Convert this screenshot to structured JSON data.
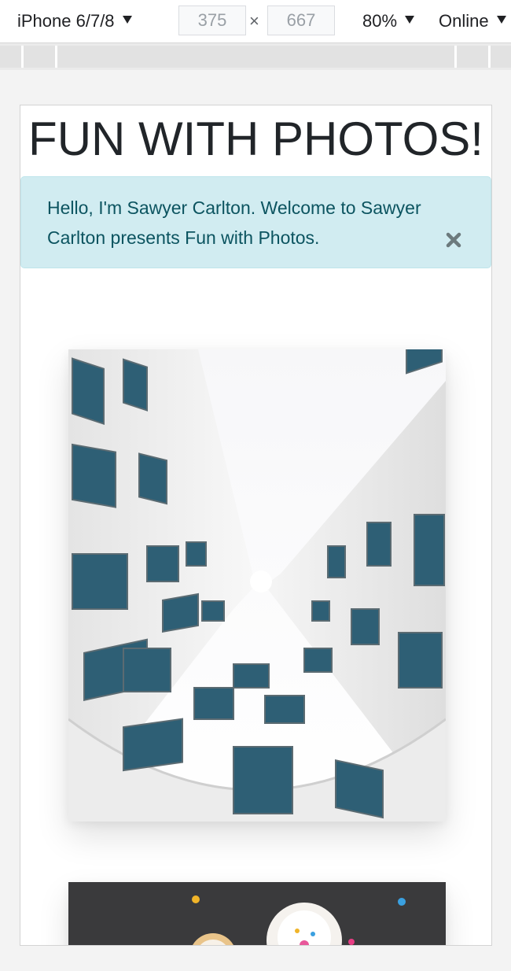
{
  "devtools": {
    "device": "iPhone 6/7/8",
    "width": "375",
    "times": "×",
    "height": "667",
    "zoom": "80%",
    "network": "Online"
  },
  "page": {
    "title": "FUN WITH PHOTOS!",
    "alert": {
      "message": "Hello, I'm Sawyer Carlton. Welcome to Sawyer Carlton presents Fun with Photos.",
      "close_icon": "close-x-icon"
    },
    "photos": [
      {
        "subject": "looking-up-building-facade"
      },
      {
        "subject": "cupcakes-top-down"
      }
    ]
  },
  "colors": {
    "alert_bg": "#d1ecf1",
    "alert_text": "#0c5460",
    "title": "#212529"
  }
}
